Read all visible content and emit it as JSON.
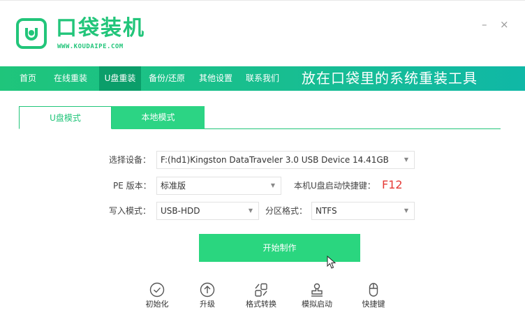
{
  "app": {
    "name": "口袋装机",
    "url": "WWW.KOUDAIPE.COM",
    "brand_color": "#22c57a",
    "minimize_glyph": "–",
    "close_glyph": "×"
  },
  "nav": {
    "items": [
      {
        "label": "首页"
      },
      {
        "label": "在线重装"
      },
      {
        "label": "U盘重装"
      },
      {
        "label": "备份/还原"
      },
      {
        "label": "其他设置"
      },
      {
        "label": "联系我们"
      }
    ],
    "active": "U盘重装",
    "slogan": "放在口袋里的系统重装工具"
  },
  "tabs": [
    {
      "label": "U盘模式",
      "active": true
    },
    {
      "label": "本地模式",
      "active": false
    }
  ],
  "form": {
    "device_label": "选择设备：",
    "device_value": "F:(hd1)Kingston DataTraveler 3.0 USB Device 14.41GB",
    "pe_label": "PE 版本：",
    "pe_value": "标准版",
    "hotkey_label": "本机U盘启动快捷键：",
    "hotkey_value": "F12",
    "write_label": "写入模式：",
    "write_value": "USB-HDD",
    "partition_label": "分区格式：",
    "partition_value": "NTFS"
  },
  "start_button": "开始制作",
  "tools": [
    {
      "label": "初始化",
      "icon": "check-circle-icon"
    },
    {
      "label": "升级",
      "icon": "upload-circle-icon"
    },
    {
      "label": "格式转换",
      "icon": "convert-icon"
    },
    {
      "label": "模拟启动",
      "icon": "stamp-icon"
    },
    {
      "label": "快捷键",
      "icon": "mouse-icon"
    }
  ]
}
